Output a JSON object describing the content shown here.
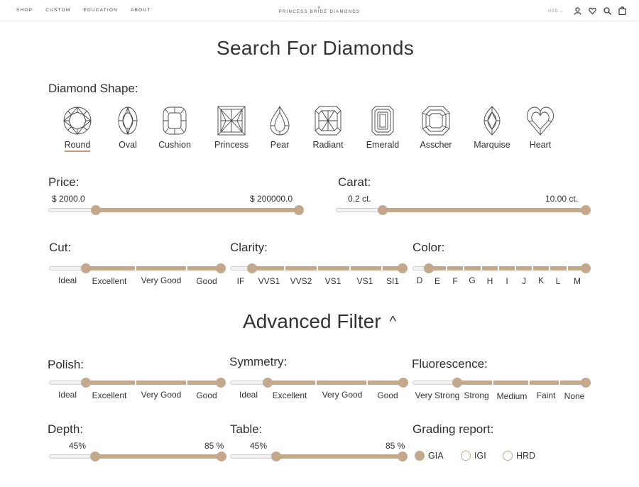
{
  "header": {
    "nav": [
      "SHOP",
      "CUSTOM",
      "EDUCATION",
      "ABOUT"
    ],
    "brand": "PRINCESS BRIDE DIAMONDS",
    "currency": "USD ⌄",
    "icons": [
      "account-icon",
      "heart-icon",
      "search-icon",
      "bag-icon"
    ]
  },
  "title": "Search For Diamonds",
  "shapes": {
    "label": "Diamond Shape:",
    "items": [
      "Round",
      "Oval",
      "Cushion",
      "Princess",
      "Pear",
      "Radiant",
      "Emerald",
      "Asscher",
      "Marquise",
      "Heart"
    ],
    "selected": "Round"
  },
  "price": {
    "label": "Price:",
    "min": "$ 2000.0",
    "max": "$ 200000.0"
  },
  "carat": {
    "label": "Carat:",
    "min": "0.2 ct.",
    "max": "10.00 ct."
  },
  "cut": {
    "label": "Cut:",
    "ticks": [
      "Ideal",
      "Excellent",
      "Very Good",
      "Good"
    ]
  },
  "clarity": {
    "label": "Clarity:",
    "ticks": [
      "IF",
      "VVS1",
      "VVS2",
      "VS1",
      "VS1",
      "SI1"
    ]
  },
  "color": {
    "label": "Color:",
    "ticks": [
      "D",
      "E",
      "F",
      "G",
      "H",
      "I",
      "J",
      "K",
      "L",
      "M"
    ]
  },
  "advanced": {
    "label": "Advanced Filter",
    "caret": "^"
  },
  "polish": {
    "label": "Polish:",
    "ticks": [
      "Ideal",
      "Excellent",
      "Very Good",
      "Good"
    ]
  },
  "symmetry": {
    "label": "Symmetry:",
    "ticks": [
      "Ideal",
      "Excellent",
      "Very Good",
      "Good"
    ]
  },
  "fluorescence": {
    "label": "Fluorescence:",
    "ticks": [
      "Very Strong",
      "Strong",
      "Medium",
      "Faint",
      "None"
    ]
  },
  "depth": {
    "label": "Depth:",
    "min": "45%",
    "max": "85 %"
  },
  "table": {
    "label": "Table:",
    "min": "45%",
    "max": "85 %"
  },
  "grading": {
    "label": "Grading report:",
    "options": [
      {
        "label": "GIA",
        "checked": true
      },
      {
        "label": "IGI",
        "checked": false
      },
      {
        "label": "HRD",
        "checked": false
      }
    ]
  },
  "colors": {
    "accent": "#c3a88c",
    "underline": "#c49a7b"
  }
}
